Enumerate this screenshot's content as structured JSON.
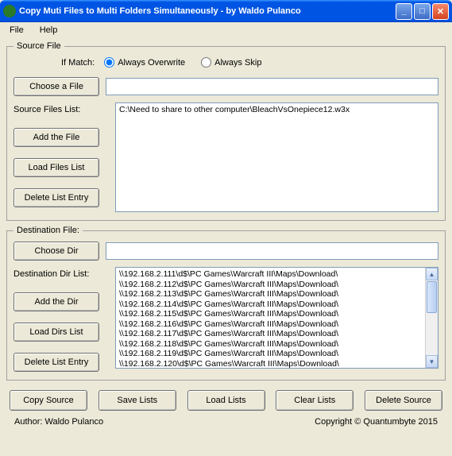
{
  "window": {
    "title": "Copy Muti Files to Multi Folders Simultaneously - by Waldo Pulanco"
  },
  "menubar": {
    "file": "File",
    "help": "Help"
  },
  "source": {
    "legend": "Source File",
    "if_match": "If Match:",
    "opt_overwrite": "Always Overwrite",
    "opt_skip": "Always Skip",
    "choose_file": "Choose a File",
    "file_input": "",
    "list_label": "Source Files List:",
    "add_file": "Add the File",
    "load_list": "Load Files List",
    "delete_entry": "Delete List Entry",
    "items": [
      "C:\\Need to share to other computer\\BleachVsOnepiece12.w3x"
    ]
  },
  "dest": {
    "legend": "Destination File:",
    "choose_dir": "Choose Dir",
    "dir_input": "",
    "list_label": "Destination Dir List:",
    "add_dir": "Add the Dir",
    "load_list": "Load Dirs List",
    "delete_entry": "Delete List Entry",
    "items": [
      "\\\\192.168.2.111\\d$\\PC Games\\Warcraft III\\Maps\\Download\\",
      "\\\\192.168.2.112\\d$\\PC Games\\Warcraft III\\Maps\\Download\\",
      "\\\\192.168.2.113\\d$\\PC Games\\Warcraft III\\Maps\\Download\\",
      "\\\\192.168.2.114\\d$\\PC Games\\Warcraft III\\Maps\\Download\\",
      "\\\\192.168.2.115\\d$\\PC Games\\Warcraft III\\Maps\\Download\\",
      "\\\\192.168.2.116\\d$\\PC Games\\Warcraft III\\Maps\\Download\\",
      "\\\\192.168.2.117\\d$\\PC Games\\Warcraft III\\Maps\\Download\\",
      "\\\\192.168.2.118\\d$\\PC Games\\Warcraft III\\Maps\\Download\\",
      "\\\\192.168.2.119\\d$\\PC Games\\Warcraft III\\Maps\\Download\\",
      "\\\\192.168.2.120\\d$\\PC Games\\Warcraft III\\Maps\\Download\\"
    ]
  },
  "bottom": {
    "copy": "Copy Source",
    "save": "Save Lists",
    "load": "Load Lists",
    "clear": "Clear Lists",
    "delete": "Delete Source"
  },
  "footer": {
    "author": "Author: Waldo Pulanco",
    "copyright": "Copyright © Quantumbyte 2015"
  }
}
